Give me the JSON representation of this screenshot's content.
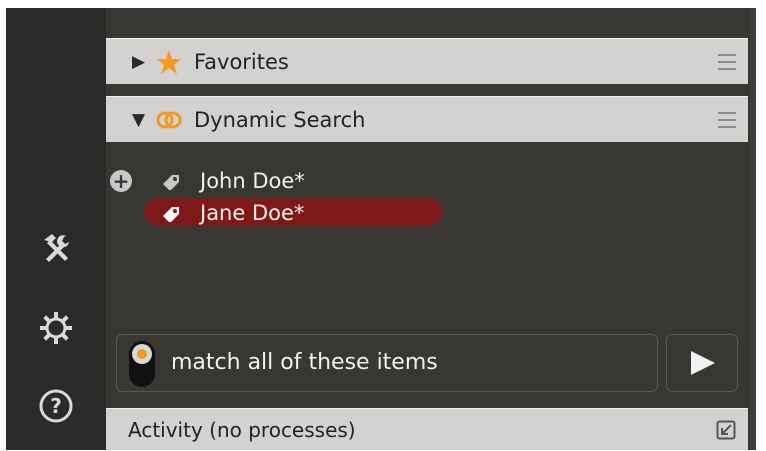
{
  "sections": {
    "favorites": {
      "title": "Favorites",
      "expanded": false,
      "icon": "star-icon"
    },
    "dynamic_search": {
      "title": "Dynamic Search",
      "expanded": true,
      "icon": "linked-rings-icon"
    }
  },
  "tree": {
    "items": [
      {
        "label": "John Doe*",
        "icon": "tag-icon",
        "selected": false
      },
      {
        "label": "Jane Doe*",
        "icon": "tag-icon",
        "selected": true
      }
    ]
  },
  "match": {
    "label": "match all of these items",
    "toggle_on": true
  },
  "activity": {
    "label": "Activity (no processes)"
  },
  "colors": {
    "accent_orange": "#f29a1f",
    "selection_red": "#7d1a17",
    "panel_dark": "#383734",
    "header_light": "#d3d2d0"
  }
}
